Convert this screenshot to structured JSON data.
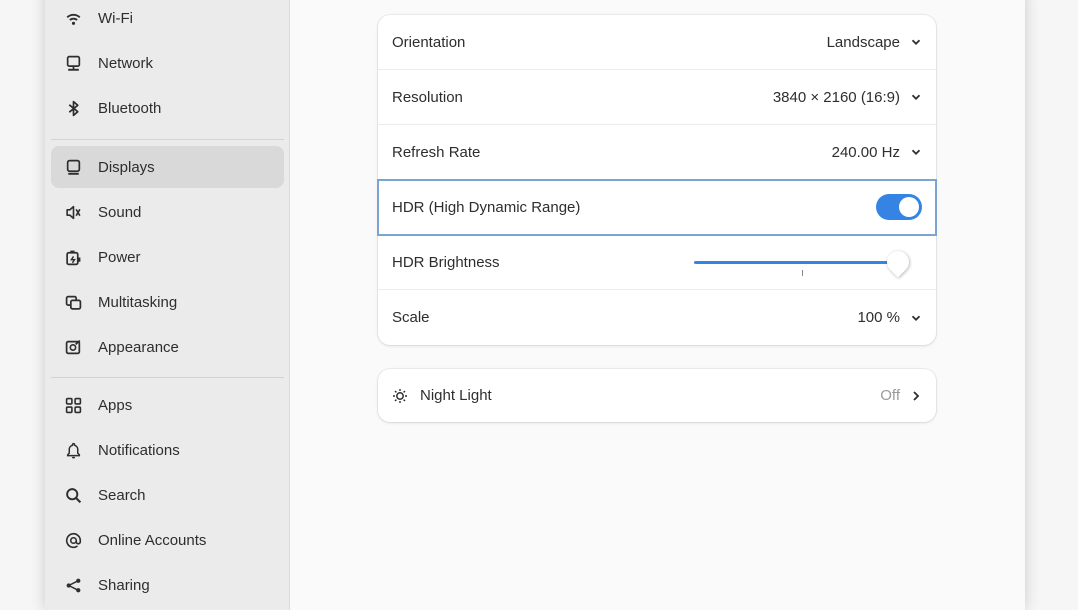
{
  "sidebar": {
    "items": [
      {
        "label": "Wi-Fi",
        "icon": "wifi-icon"
      },
      {
        "label": "Network",
        "icon": "network-icon"
      },
      {
        "label": "Bluetooth",
        "icon": "bluetooth-icon"
      },
      {
        "label": "Displays",
        "icon": "display-icon",
        "active": true
      },
      {
        "label": "Sound",
        "icon": "sound-icon"
      },
      {
        "label": "Power",
        "icon": "power-icon"
      },
      {
        "label": "Multitasking",
        "icon": "multitasking-icon"
      },
      {
        "label": "Appearance",
        "icon": "appearance-icon"
      },
      {
        "label": "Apps",
        "icon": "apps-icon"
      },
      {
        "label": "Notifications",
        "icon": "bell-icon"
      },
      {
        "label": "Search",
        "icon": "search-icon"
      },
      {
        "label": "Online Accounts",
        "icon": "at-icon"
      },
      {
        "label": "Sharing",
        "icon": "share-icon"
      }
    ]
  },
  "display_settings": {
    "orientation": {
      "label": "Orientation",
      "value": "Landscape"
    },
    "resolution": {
      "label": "Resolution",
      "value": "3840 × 2160 (16:9)"
    },
    "refresh_rate": {
      "label": "Refresh Rate",
      "value": "240.00 Hz"
    },
    "hdr": {
      "label": "HDR (High Dynamic Range)",
      "enabled": true
    },
    "hdr_brightness": {
      "label": "HDR Brightness",
      "level": 1.0
    },
    "scale": {
      "label": "Scale",
      "value": "100 %"
    }
  },
  "night_light": {
    "label": "Night Light",
    "value": "Off"
  },
  "colors": {
    "accent": "#3584e4",
    "focus": "#7ba4d2"
  }
}
